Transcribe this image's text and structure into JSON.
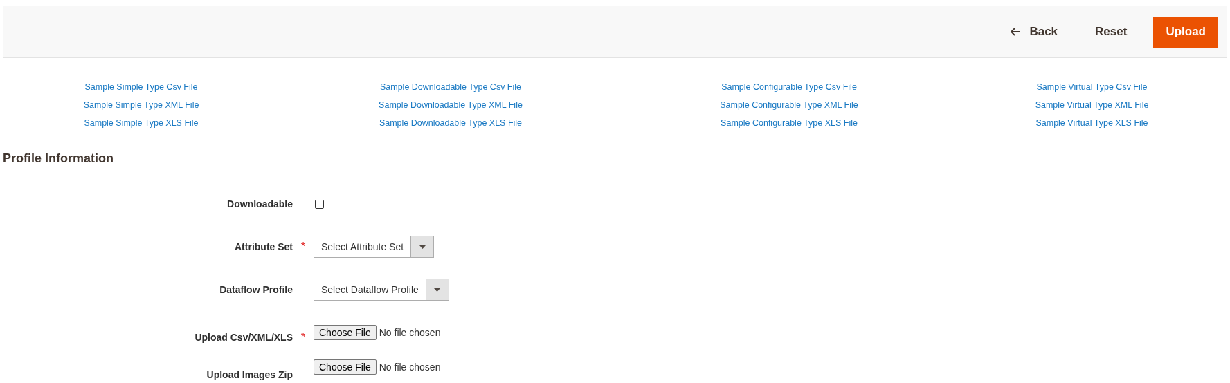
{
  "toolbar": {
    "buttons": [
      {
        "kind": "back",
        "label": "Back"
      },
      {
        "kind": "plain",
        "label": "Reset"
      },
      {
        "kind": "primary",
        "label": "Upload"
      }
    ]
  },
  "sample_links": [
    {
      "links": [
        "Sample Simple Type Csv File",
        "Sample Simple Type XML File",
        "Sample Simple Type XLS File"
      ]
    },
    {
      "links": [
        "Sample Downloadable Type Csv File",
        "Sample Downloadable Type XML File",
        "Sample Downloadable Type XLS File"
      ]
    },
    {
      "links": [
        "Sample Configurable Type Csv File",
        "Sample Configurable Type XML File",
        "Sample Configurable Type XLS File"
      ]
    },
    {
      "links": [
        "Sample Virtual Type Csv File",
        "Sample Virtual Type XML File",
        "Sample Virtual Type XLS File"
      ]
    }
  ],
  "section_title": "Profile Information",
  "fields": [
    {
      "kind": "checkbox",
      "label": "Downloadable",
      "checked": false
    },
    {
      "kind": "select",
      "label": "Attribute Set",
      "required_mark": "*",
      "value": "Select Attribute Set"
    },
    {
      "kind": "select",
      "label": "Dataflow Profile",
      "value": "Select Dataflow Profile"
    },
    {
      "kind": "file",
      "label": "Upload Csv/XML/XLS",
      "required_mark": "*",
      "button": "Choose File",
      "status": "No file chosen"
    },
    {
      "kind": "file",
      "label": "Upload Images Zip",
      "button": "Choose File",
      "status": "No file chosen"
    }
  ]
}
